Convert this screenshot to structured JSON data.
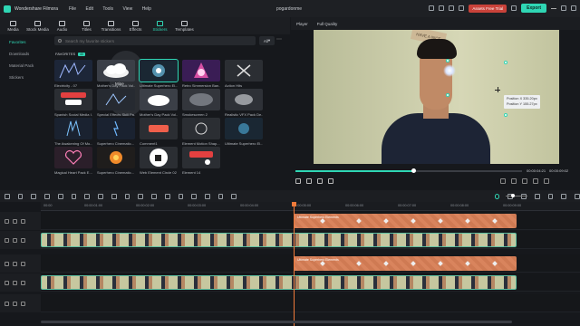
{
  "app": {
    "name": "Wondershare Filmora",
    "menu": [
      "File",
      "Edit",
      "Tools",
      "View",
      "Help"
    ],
    "project": "pogardonme",
    "trial_label": "Assets Free Trial",
    "export_label": "Export"
  },
  "toolbar": {
    "tools": [
      {
        "label": "Media",
        "icon": "media-icon"
      },
      {
        "label": "Stock Media",
        "icon": "stock-media-icon"
      },
      {
        "label": "Audio",
        "icon": "audio-icon"
      },
      {
        "label": "Titles",
        "icon": "titles-icon"
      },
      {
        "label": "Transitions",
        "icon": "transitions-icon"
      },
      {
        "label": "Effects",
        "icon": "effects-icon"
      },
      {
        "label": "Stickers",
        "icon": "stickers-icon"
      },
      {
        "label": "Templates",
        "icon": "templates-icon"
      }
    ],
    "active": "Stickers"
  },
  "leftnav": {
    "items": [
      {
        "label": "Mine",
        "state": "head"
      },
      {
        "label": "Favorites",
        "state": "selected"
      },
      {
        "label": "Downloads",
        "state": ""
      },
      {
        "label": "Material Pack",
        "state": ""
      },
      {
        "label": "Stickers",
        "state": ""
      }
    ]
  },
  "search": {
    "placeholder": "Search my favorite stickers",
    "filter": "All"
  },
  "favorites": {
    "label": "FAVORITES",
    "count": "40"
  },
  "stickers": [
    {
      "label": "Electricity - 07"
    },
    {
      "label": "Mother's Day Pack Vol..."
    },
    {
      "label": "Ultimate Superhero El..."
    },
    {
      "label": "Retro Simmersion Ban..."
    },
    {
      "label": "Action Hits"
    },
    {
      "label": "Spanish Social Media I..."
    },
    {
      "label": "Special Effects Skill Pa..."
    },
    {
      "label": "Mother's Day Pack Vol..."
    },
    {
      "label": "Smokescreen 2"
    },
    {
      "label": "Realistic VFX Pack De..."
    },
    {
      "label": "The Awakening Of Mo..."
    },
    {
      "label": "Superhero Cinematic..."
    },
    {
      "label": "Comment1"
    },
    {
      "label": "Element Motion Shap..."
    },
    {
      "label": "Ultimate Superhero El..."
    },
    {
      "label": "Magical Heart Pack E..."
    },
    {
      "label": "Superhero Cinematic..."
    },
    {
      "label": "Web Element Circle 02"
    },
    {
      "label": "Element 14"
    }
  ],
  "preview": {
    "tab_player": "Player",
    "tab_quality": "Full Quality",
    "sign_text": "HAVE A NICE",
    "tooltip_x": "Position X 335.20px",
    "tooltip_y": "Position Y 155.27px",
    "time_current": "00:00:04:21",
    "time_total": "00:00:09:02",
    "progress": 0.52
  },
  "timeline": {
    "ruler": [
      "00:00",
      "00:00:01:00",
      "00:00:02:00",
      "00:00:03:00",
      "00:00:04:00",
      "00:00:05:00",
      "00:00:06:00",
      "00:00:07:00",
      "00:00:08:00",
      "00:00:09:00"
    ],
    "clip1_label": "Ultimate Superhero Elements",
    "clip2_label": "Ultimate Superhero Elements"
  },
  "colors": {
    "accent": "#2fd6b4",
    "trial": "#c9423a",
    "sticker_clip": "#d9845d",
    "playhead": "#f07a3a"
  }
}
